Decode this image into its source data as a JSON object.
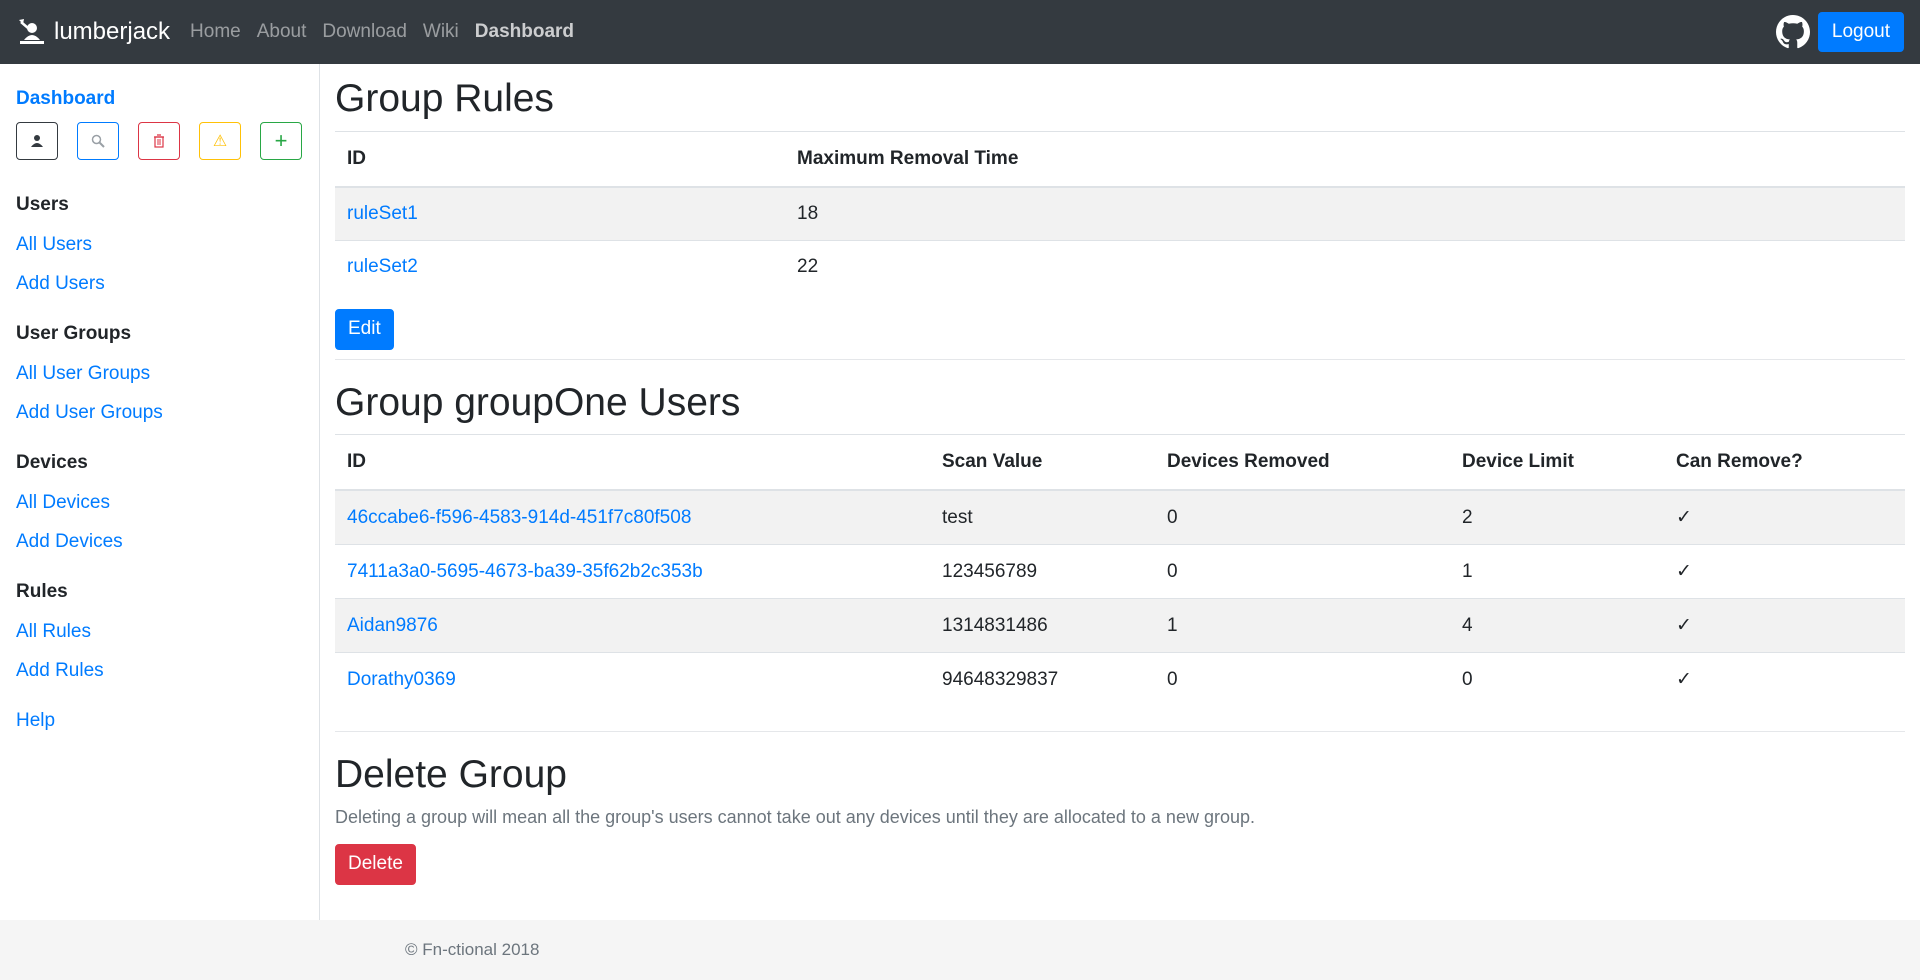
{
  "navbar": {
    "brand": "lumberjack",
    "links": [
      "Home",
      "About",
      "Download",
      "Wiki",
      "Dashboard"
    ],
    "active_link": "Dashboard",
    "github_icon": "github-icon",
    "logout_label": "Logout"
  },
  "sidebar": {
    "top_link": "Dashboard",
    "quick_icons": [
      "user-icon",
      "search-icon",
      "trash-icon",
      "warning-icon",
      "plus-icon"
    ],
    "sections": [
      {
        "heading": "Users",
        "links": [
          "All Users",
          "Add Users"
        ]
      },
      {
        "heading": "User Groups",
        "links": [
          "All User Groups",
          "Add User Groups"
        ]
      },
      {
        "heading": "Devices",
        "links": [
          "All Devices",
          "Add Devices"
        ]
      },
      {
        "heading": "Rules",
        "links": [
          "All Rules",
          "Add Rules"
        ]
      }
    ],
    "help": "Help"
  },
  "group_rules": {
    "title": "Group Rules",
    "headers": [
      "ID",
      "Maximum Removal Time"
    ],
    "rows": [
      [
        "ruleSet1",
        "18"
      ],
      [
        "ruleSet2",
        "22"
      ]
    ],
    "edit_label": "Edit"
  },
  "group_users": {
    "title": "Group groupOne Users",
    "headers": [
      "ID",
      "Scan Value",
      "Devices Removed",
      "Device Limit",
      "Can Remove?"
    ],
    "rows": [
      [
        "46ccabe6-f596-4583-914d-451f7c80f508",
        "test",
        "0",
        "2",
        "✓"
      ],
      [
        "7411a3a0-5695-4673-ba39-35f62b2c353b",
        "123456789",
        "0",
        "1",
        "✓"
      ],
      [
        "Aidan9876",
        "1314831486",
        "1",
        "4",
        "✓"
      ],
      [
        "Dorathy0369",
        "94648329837",
        "0",
        "0",
        "✓"
      ]
    ]
  },
  "delete_group": {
    "title": "Delete Group",
    "text": "Deleting a group will mean all the group's users cannot take out any devices until they are allocated to a new group.",
    "button_label": "Delete"
  },
  "footer": {
    "text": "© Fn-ctional 2018"
  },
  "colors": {
    "navbar": "#343a40",
    "primary": "#007bff",
    "danger": "#dc3545",
    "warning": "#ffc107",
    "success": "#28a745"
  }
}
